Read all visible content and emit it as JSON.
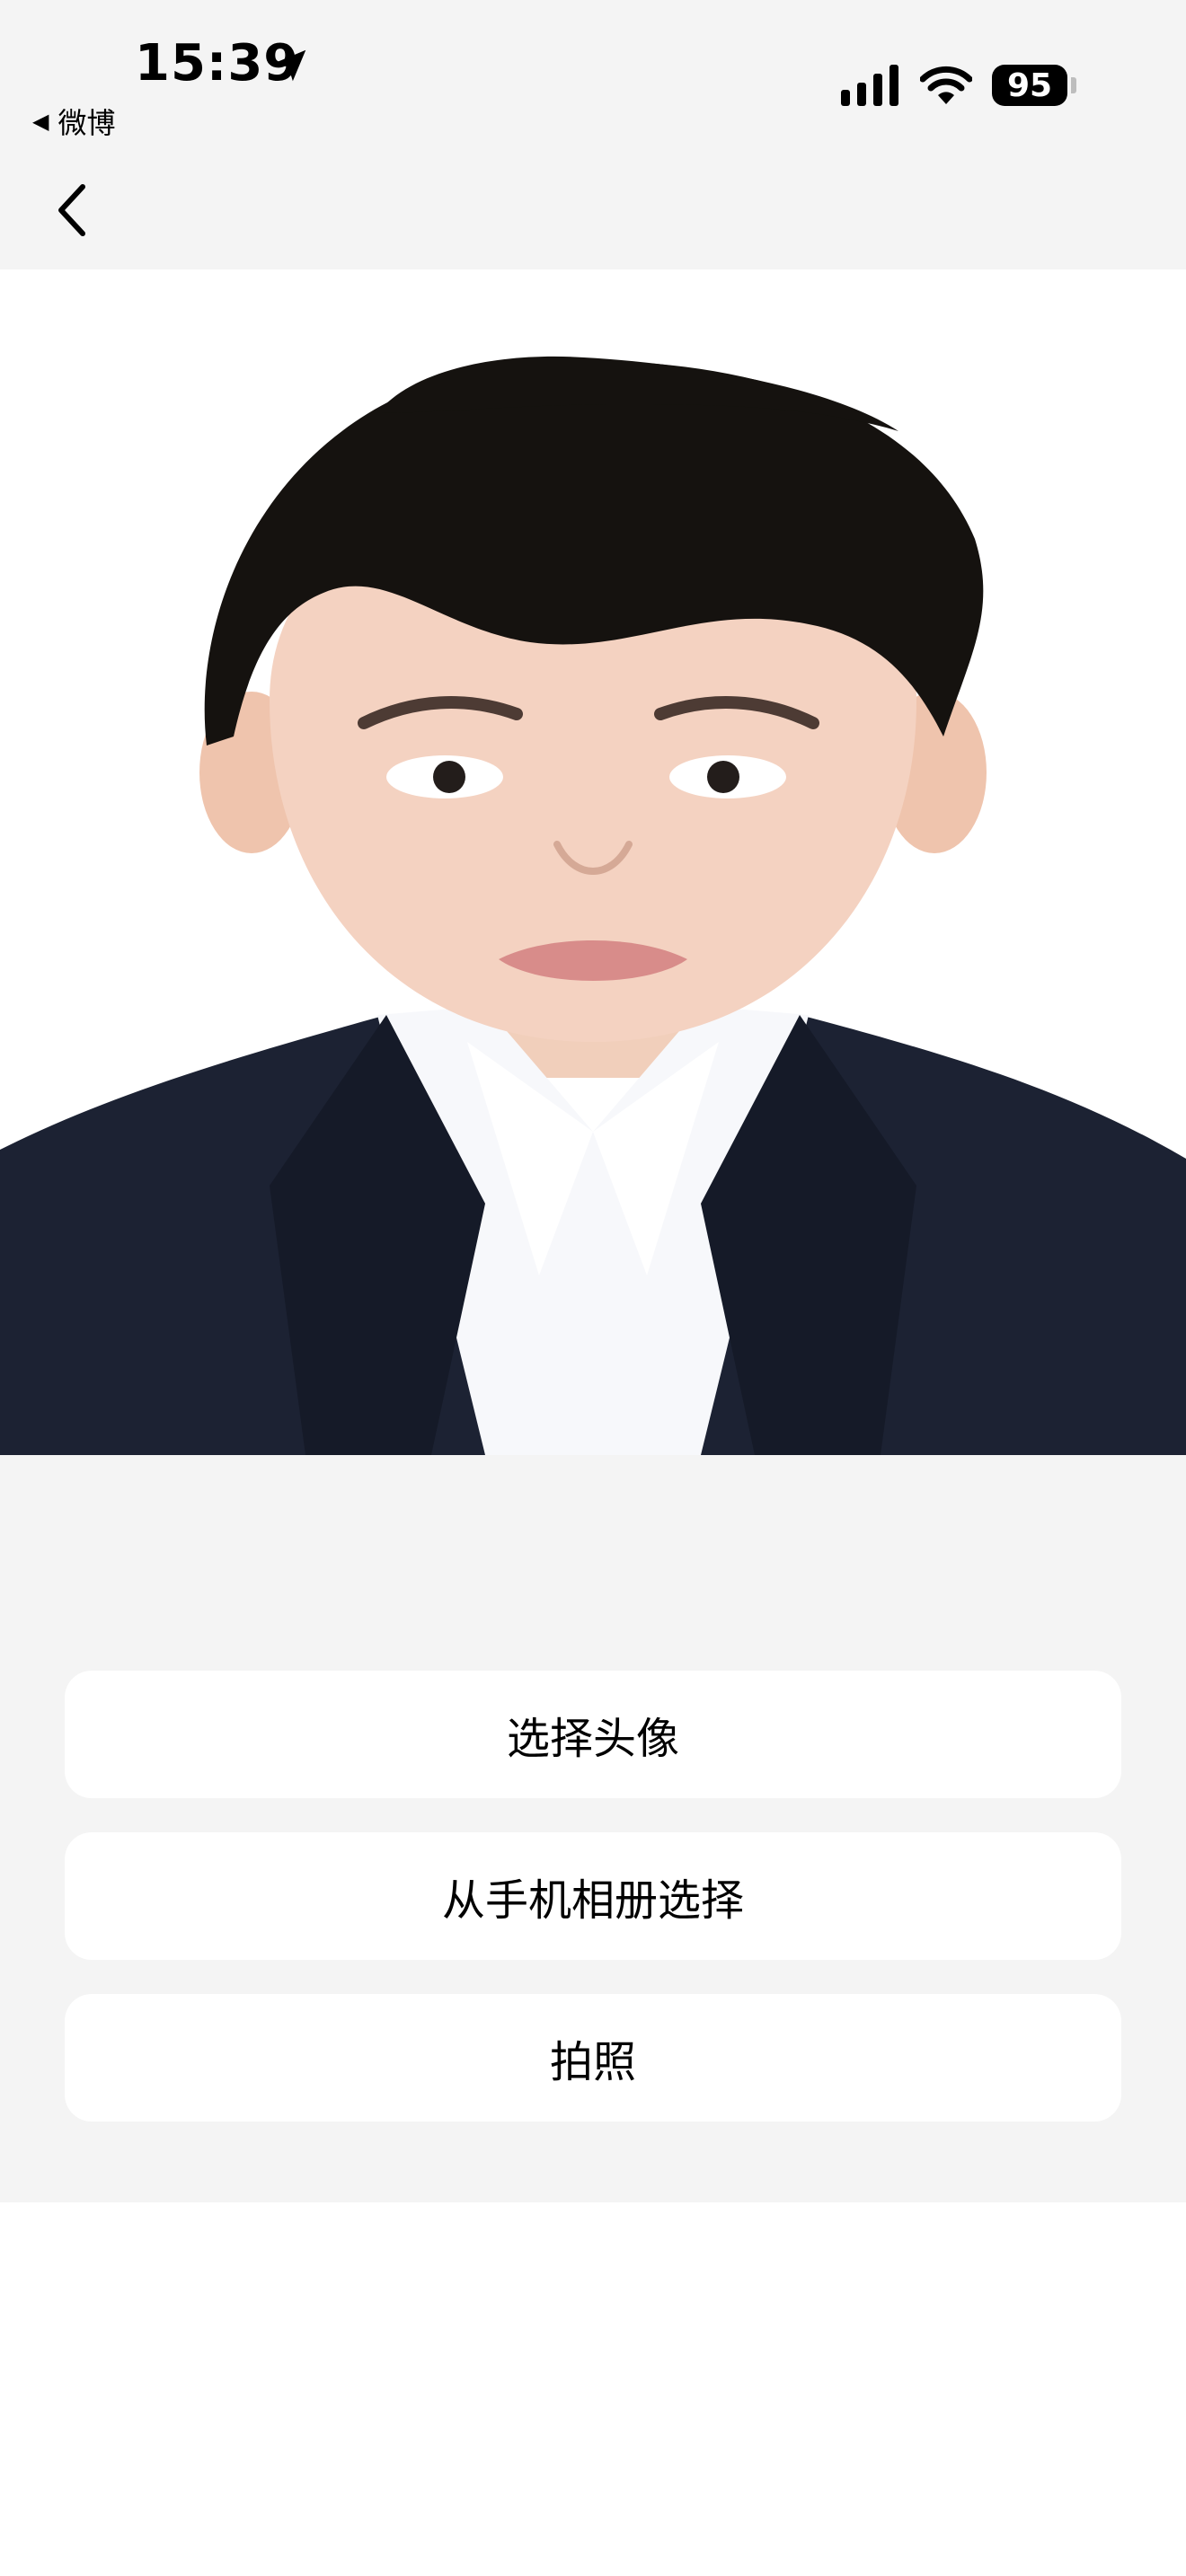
{
  "status_bar": {
    "time": "15:39",
    "back_app": "微博",
    "battery": "95"
  },
  "icons": {
    "location": "location-arrow-icon",
    "signal": "cellular-signal-icon",
    "wifi": "wifi-icon",
    "back": "chevron-left-icon"
  },
  "photo": {
    "subject": "boy in dark suit and white shirt",
    "background_color": "#ffffff"
  },
  "actions": {
    "select_avatar": "选择头像",
    "from_album": "从手机相册选择",
    "take_photo": "拍照"
  },
  "colors": {
    "sheet_bg": "#f4f4f4",
    "button_bg": "#ffffff",
    "text": "#000000"
  }
}
